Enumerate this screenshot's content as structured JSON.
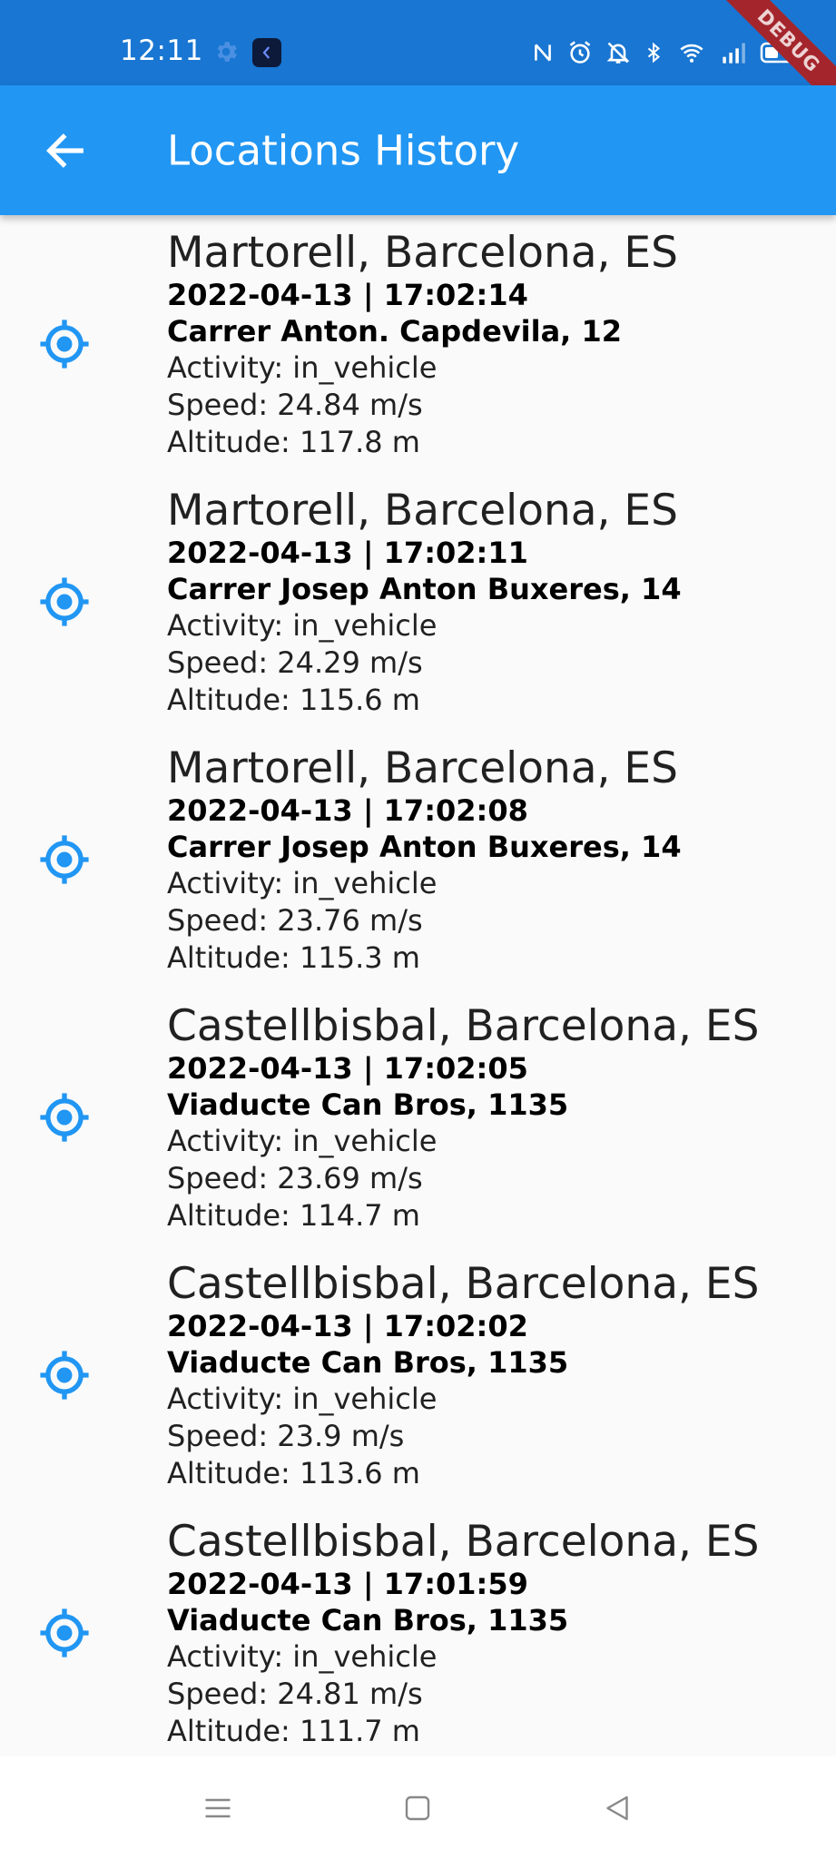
{
  "status_bar": {
    "time": "12:11",
    "debug_label": "DEBUG"
  },
  "app_bar": {
    "title": "Locations History",
    "back_icon": "arrow-back-icon"
  },
  "colors": {
    "app_bar": "#2196f3",
    "status_bar": "#1976d2",
    "accent_icon": "#2196f3",
    "background": "#fafafa"
  },
  "locations": [
    {
      "city": "Martorell, Barcelona, ES",
      "datetime": "2022-04-13 | 17:02:14",
      "street": "Carrer Anton. Capdevila, 12",
      "activity": "Activity: in_vehicle",
      "speed": "Speed: 24.84 m/s",
      "altitude": "Altitude: 117.8 m"
    },
    {
      "city": "Martorell, Barcelona, ES",
      "datetime": "2022-04-13 | 17:02:11",
      "street": "Carrer Josep Anton Buxeres, 14",
      "activity": "Activity: in_vehicle",
      "speed": "Speed: 24.29 m/s",
      "altitude": "Altitude: 115.6 m"
    },
    {
      "city": "Martorell, Barcelona, ES",
      "datetime": "2022-04-13 | 17:02:08",
      "street": "Carrer Josep Anton Buxeres, 14",
      "activity": "Activity: in_vehicle",
      "speed": "Speed: 23.76 m/s",
      "altitude": "Altitude: 115.3 m"
    },
    {
      "city": "Castellbisbal, Barcelona, ES",
      "datetime": "2022-04-13 | 17:02:05",
      "street": "Viaducte Can Bros, 1135",
      "activity": "Activity: in_vehicle",
      "speed": "Speed: 23.69 m/s",
      "altitude": "Altitude: 114.7 m"
    },
    {
      "city": "Castellbisbal, Barcelona, ES",
      "datetime": "2022-04-13 | 17:02:02",
      "street": "Viaducte Can Bros, 1135",
      "activity": "Activity: in_vehicle",
      "speed": "Speed: 23.9 m/s",
      "altitude": "Altitude: 113.6 m"
    },
    {
      "city": "Castellbisbal, Barcelona, ES",
      "datetime": "2022-04-13 | 17:01:59",
      "street": "Viaducte Can Bros, 1135",
      "activity": "Activity: in_vehicle",
      "speed": "Speed: 24.81 m/s",
      "altitude": "Altitude: 111.7 m"
    }
  ],
  "nav_bar": {
    "buttons": [
      "menu-icon",
      "home-square-icon",
      "back-triangle-icon"
    ]
  }
}
